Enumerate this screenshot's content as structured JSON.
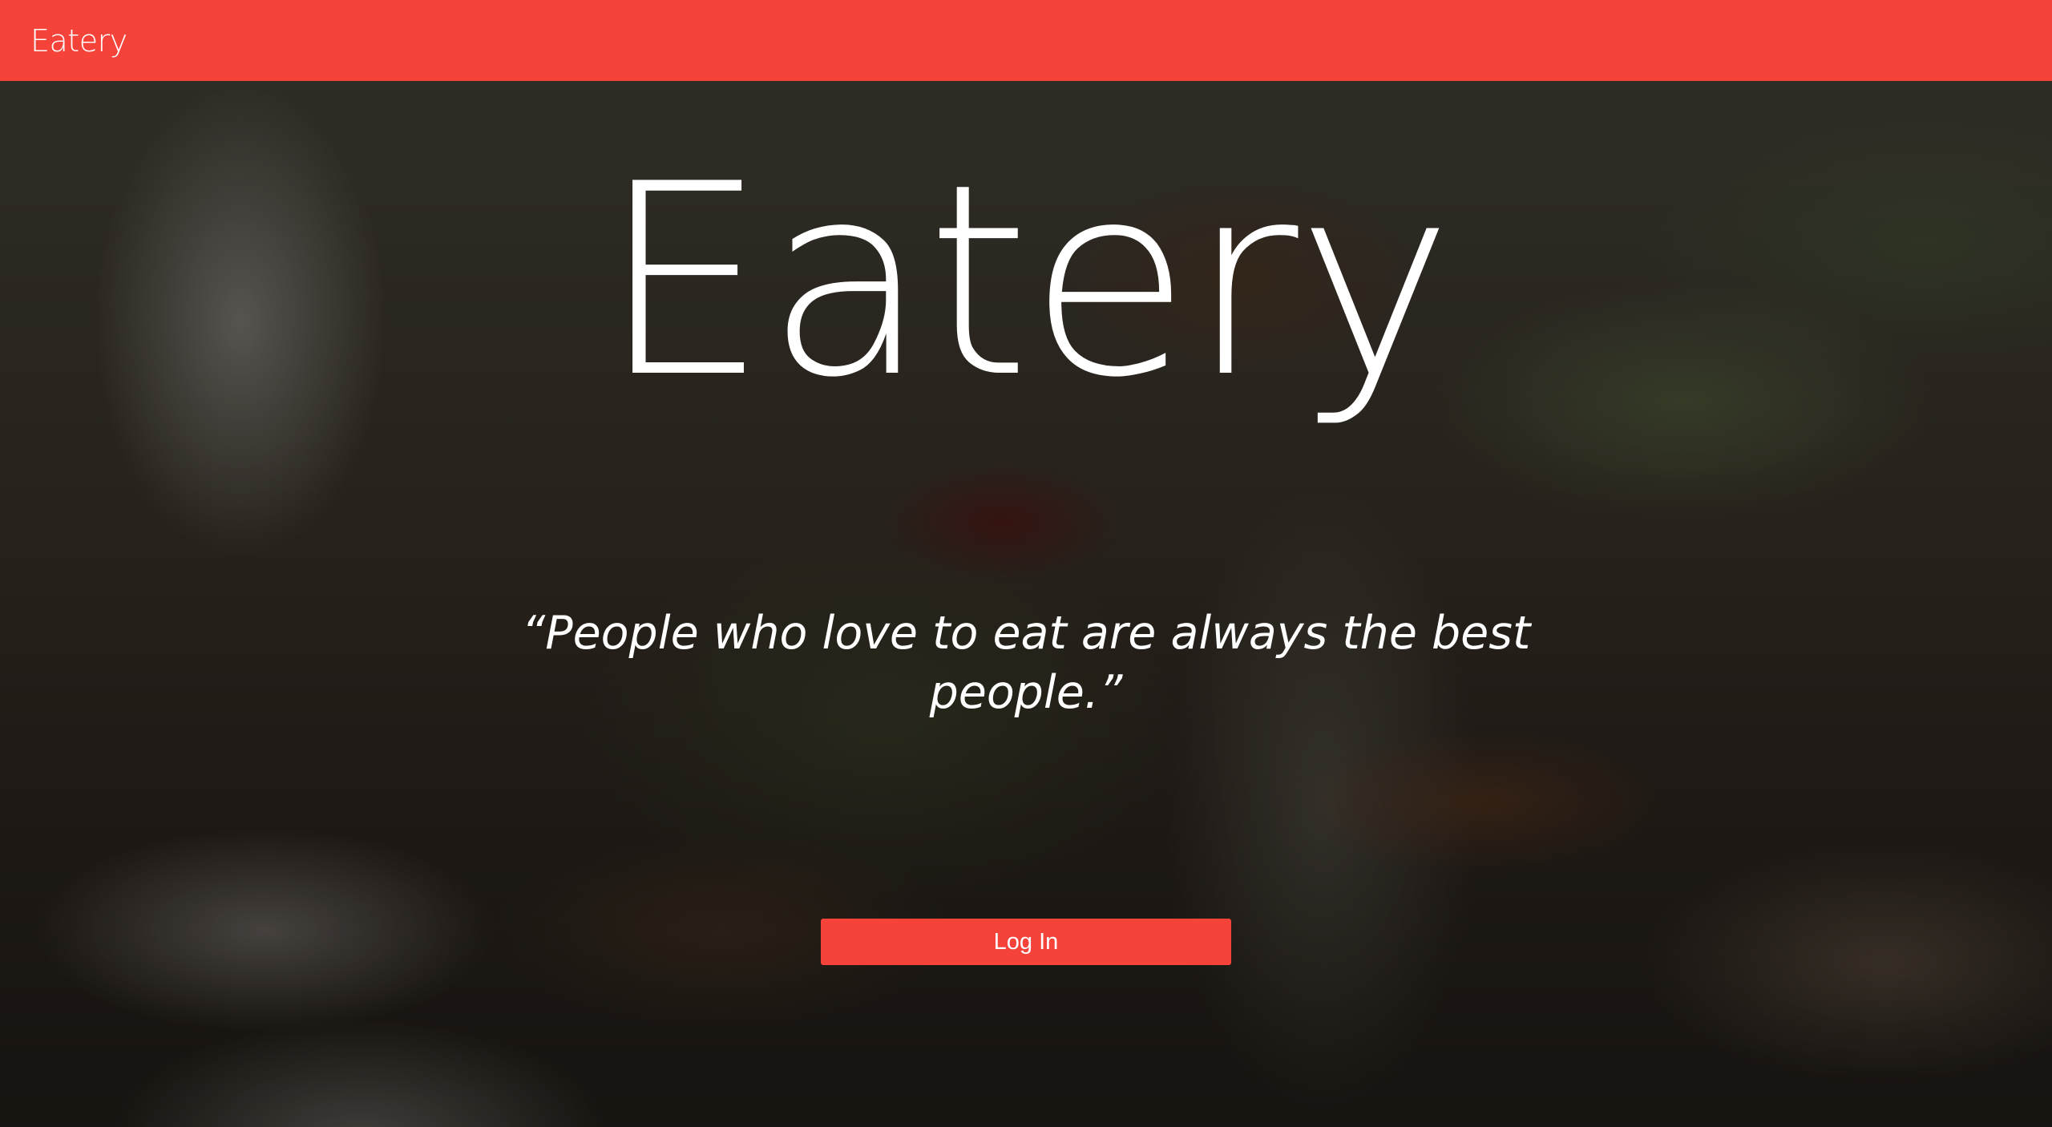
{
  "navbar": {
    "brand": "Eatery"
  },
  "hero": {
    "title": "Eatery",
    "quote": "“People who love to eat are always the best people.”",
    "login_label": "Log In"
  },
  "colors": {
    "accent": "#f5433a",
    "text": "#ffffff"
  }
}
